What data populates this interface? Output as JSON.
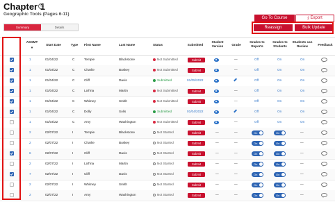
{
  "header": {
    "title": "Chapter 1",
    "info_icon": "info-icon",
    "subtitle": "Geographic Tools (Pages 6-11)"
  },
  "tabs": [
    {
      "label": "Summary",
      "active": true
    },
    {
      "label": "Details",
      "active": false
    }
  ],
  "actions": {
    "go_to_course": "Go To Course",
    "export": "Export",
    "export_icon": "download-icon",
    "reassign": "Reassign",
    "bulk_update": "Bulk Update"
  },
  "columns": {
    "assgmt": "ASGMT",
    "sort_icon": "sort-down-icon",
    "start_date": "Start Date",
    "type": "Type",
    "first_name": "First Name",
    "last_name": "Last Name",
    "status": "Status",
    "submitted": "Submitted",
    "student_version": "Student Version",
    "grade": "Grade",
    "grades_to_reports": "Grades to Reports",
    "grades_to_students": "Grades to Students",
    "students_can_review": "Students can Review",
    "feedback": "Feedback"
  },
  "colors": {
    "brand_red": "#c8102e",
    "link_blue": "#2d73c8",
    "toggle_blue": "#2d64b3",
    "submitted_green": "#2a9c47",
    "highlight_frame": "#e01010"
  },
  "rows": [
    {
      "checked": true,
      "asgmt": "1",
      "start": "01/04/22",
      "type": "C",
      "first": "Tempie",
      "last": "Blackstone",
      "status": "Not Submitted",
      "status_kind": "ns",
      "submitted": "Submit",
      "sv": "eye",
      "grade": "—",
      "g2r": "Off",
      "g2s": "On",
      "review": "On"
    },
    {
      "checked": true,
      "asgmt": "1",
      "start": "01/04/22",
      "type": "C",
      "first": "Charlie",
      "last": "Buskey",
      "status": "Not Submitted",
      "status_kind": "ns",
      "submitted": "Submit",
      "sv": "eye",
      "grade": "—",
      "g2r": "Off",
      "g2s": "On",
      "review": "On"
    },
    {
      "checked": true,
      "asgmt": "1",
      "start": "01/04/22",
      "type": "C",
      "first": "Cliff",
      "last": "Davis",
      "status": "Submitted",
      "status_kind": "sub",
      "submitted": "01/05/2022",
      "sv": "eye",
      "grade": "pencil",
      "g2r": "Off",
      "g2s": "On",
      "review": "On"
    },
    {
      "checked": true,
      "asgmt": "1",
      "start": "01/04/22",
      "type": "C",
      "first": "LaTina",
      "last": "Martin",
      "status": "Not Submitted",
      "status_kind": "ns",
      "submitted": "Submit",
      "sv": "eye",
      "grade": "—",
      "g2r": "Off",
      "g2s": "On",
      "review": "On"
    },
    {
      "checked": true,
      "asgmt": "1",
      "start": "01/04/22",
      "type": "C",
      "first": "Whitney",
      "last": "Smith",
      "status": "Not Submitted",
      "status_kind": "ns",
      "submitted": "Submit",
      "sv": "eye",
      "grade": "—",
      "g2r": "Off",
      "g2s": "On",
      "review": "On"
    },
    {
      "checked": true,
      "asgmt": "1",
      "start": "01/04/22",
      "type": "C",
      "first": "Dolly",
      "last": "Solis",
      "status": "Submitted",
      "status_kind": "sub",
      "submitted": "01/04/2022",
      "sv": "eye",
      "grade": "pencil",
      "g2r": "Off",
      "g2s": "On",
      "review": "On"
    },
    {
      "checked": false,
      "asgmt": "1",
      "start": "01/04/22",
      "type": "C",
      "first": "Amy",
      "last": "Washington",
      "status": "Not Submitted",
      "status_kind": "ns",
      "submitted": "Submit",
      "sv": "eye",
      "grade": "—",
      "g2r": "Off",
      "g2s": "On",
      "review": "On"
    },
    {
      "checked": false,
      "asgmt": "2",
      "start": "02/07/22",
      "type": "I",
      "first": "Tempie",
      "last": "Blackstone",
      "status": "Not Started",
      "status_kind": "nst",
      "submitted": "Submit",
      "sv": "—",
      "grade": "—",
      "g2r": "On",
      "g2s": "On",
      "review": "—"
    },
    {
      "checked": false,
      "asgmt": "2",
      "start": "02/07/22",
      "type": "I",
      "first": "Charlie",
      "last": "Buskey",
      "status": "Not Started",
      "status_kind": "nst",
      "submitted": "Submit",
      "sv": "—",
      "grade": "—",
      "g2r": "On",
      "g2s": "On",
      "review": "—"
    },
    {
      "checked": true,
      "asgmt": "6",
      "start": "02/07/22",
      "type": "I",
      "first": "Cliff",
      "last": "Davis",
      "status": "Not Started",
      "status_kind": "nst",
      "submitted": "Submit",
      "sv": "—",
      "grade": "—",
      "g2r": "On",
      "g2s": "On",
      "review": "—"
    },
    {
      "checked": false,
      "asgmt": "2",
      "start": "02/07/22",
      "type": "I",
      "first": "LaTina",
      "last": "Martin",
      "status": "Not Started",
      "status_kind": "nst",
      "submitted": "Submit",
      "sv": "—",
      "grade": "—",
      "g2r": "On",
      "g2s": "On",
      "review": "—"
    },
    {
      "checked": true,
      "asgmt": "7",
      "start": "02/07/22",
      "type": "I",
      "first": "Cliff",
      "last": "Davis",
      "status": "Not Started",
      "status_kind": "nst",
      "submitted": "Submit",
      "sv": "—",
      "grade": "—",
      "g2r": "On",
      "g2s": "On",
      "review": "—"
    },
    {
      "checked": false,
      "asgmt": "2",
      "start": "02/07/22",
      "type": "I",
      "first": "Whitney",
      "last": "Smith",
      "status": "Not Started",
      "status_kind": "nst",
      "submitted": "Submit",
      "sv": "—",
      "grade": "—",
      "g2r": "On",
      "g2s": "On",
      "review": "—"
    },
    {
      "checked": false,
      "asgmt": "2",
      "start": "02/07/22",
      "type": "I",
      "first": "Amy",
      "last": "Washington",
      "status": "Not Started",
      "status_kind": "nst",
      "submitted": "Submit",
      "sv": "—",
      "grade": "—",
      "g2r": "On",
      "g2s": "On",
      "review": "—"
    }
  ]
}
